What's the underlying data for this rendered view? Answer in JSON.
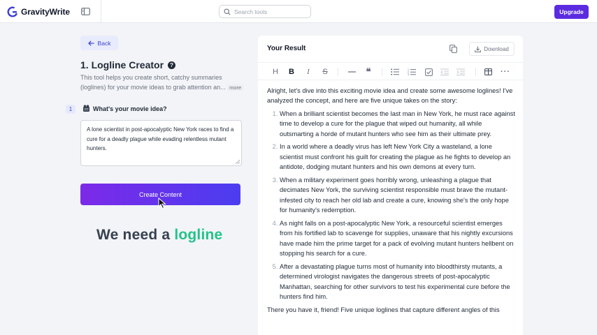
{
  "header": {
    "brand": "GravityWrite",
    "search_placeholder": "Search tools",
    "upgrade_label": "Upgrade",
    "icons": [
      "gravitywrite-logo-icon",
      "sidebar-toggle-icon",
      "search-icon"
    ]
  },
  "tool": {
    "back_label": "Back",
    "title": "1. Logline Creator",
    "description": "This tool helps you create short, catchy summaries (loglines) for your movie ideas to grab attention an...",
    "more_label": "more",
    "step_number": "1",
    "step_label": "What's your movie idea?",
    "input_value": "A lone scientist in post-apocalyptic New York races to find a cure for a deadly plague while evading relentless mutant hunters.",
    "create_label": "Create Content",
    "tagline_prefix": "We need a",
    "tagline_accent": "logline"
  },
  "result": {
    "title": "Your Result",
    "download_label": "Download",
    "toolbar_icons": [
      "heading-icon",
      "bold-icon",
      "italic-icon",
      "strikethrough-icon",
      "horizontal-rule-icon",
      "quote-icon",
      "bullet-list-icon",
      "numbered-list-icon",
      "checklist-icon",
      "outdent-icon",
      "indent-icon",
      "table-icon",
      "more-icon"
    ],
    "intro": "Alright, let's dive into this exciting movie idea and create some awesome loglines! I've analyzed the concept, and here are five unique takes on the story:",
    "loglines": [
      "When a brilliant scientist becomes the last man in New York, he must race against time to develop a cure for the plague that wiped out humanity, all while outsmarting a horde of mutant hunters who see him as their ultimate prey.",
      "In a world where a deadly virus has left New York City a wasteland, a lone scientist must confront his guilt for creating the plague as he fights to develop an antidote, dodging mutant hunters and his own demons at every turn.",
      "When a military experiment goes horribly wrong, unleashing a plague that decimates New York, the surviving scientist responsible must brave the mutant-infested city to reach her old lab and create a cure, knowing she's the only hope for humanity's redemption.",
      "As night falls on a post-apocalyptic New York, a resourceful scientist emerges from his fortified lab to scavenge for supplies, unaware that his nightly excursions have made him the prime target for a pack of evolving mutant hunters hellbent on stopping his search for a cure.",
      "After a devastating plague turns most of humanity into bloodthirsty mutants, a determined virologist navigates the dangerous streets of post-apocalyptic Manhattan, searching for other survivors to test his experimental cure before the hunters find him."
    ],
    "outro": "There you have it, friend! Five unique loglines that capture different angles of this"
  },
  "colors": {
    "brand": "#5b2be0",
    "accent_green": "#22c389",
    "button_gradient_start": "#7c2ae8",
    "button_gradient_end": "#4b3df0"
  }
}
